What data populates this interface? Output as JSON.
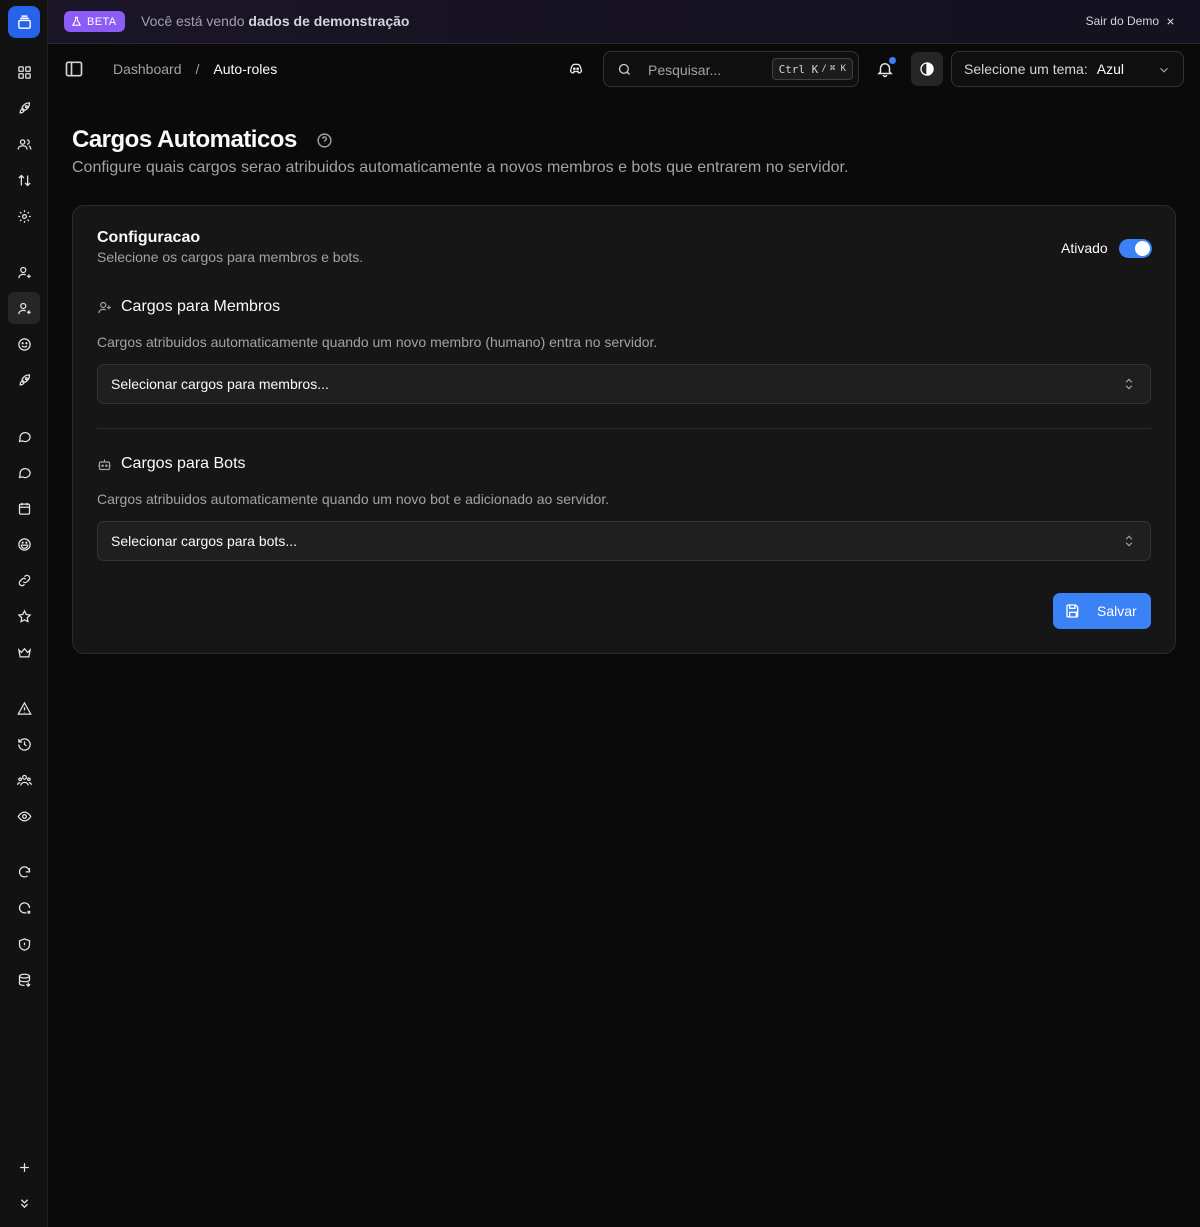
{
  "banner": {
    "badge": "BETA",
    "text_prefix": "Você está vendo",
    "text_bold": "dados de demonstração",
    "exit_label": "Sair do Demo"
  },
  "header": {
    "breadcrumb": {
      "root": "Dashboard",
      "separator": "/",
      "current": "Auto-roles"
    },
    "search": {
      "placeholder": "Pesquisar...",
      "shortcut_ctrl": "Ctrl K",
      "shortcut_sep": "/",
      "shortcut_cmd": "⌘ K"
    },
    "theme": {
      "label": "Selecione um tema:",
      "value": "Azul"
    }
  },
  "sidebar": {
    "icons": [
      "grid-icon",
      "rocket-icon",
      "users-icon",
      "arrows-updown-icon",
      "gear-icon",
      "user-plus-icon",
      "user-plus-icon",
      "smile-icon",
      "rocket-icon",
      "message-icon",
      "message-icon",
      "calendar-icon",
      "emoji-icon",
      "link-icon",
      "star-icon",
      "crown-icon",
      "warning-icon",
      "history-icon",
      "team-icon",
      "eye-icon",
      "shield-refresh-icon",
      "shield-x-icon",
      "shield-icon",
      "database-icon",
      "plus-icon",
      "chevrons-down-icon"
    ],
    "active_index": 6
  },
  "page": {
    "title": "Cargos Automaticos",
    "subtitle": "Configure quais cargos serao atribuidos automaticamente a novos membros e bots que entrarem no servidor."
  },
  "card": {
    "title": "Configuracao",
    "description": "Selecione os cargos para membros e bots.",
    "toggle_label": "Ativado",
    "toggle_on": true,
    "members": {
      "heading": "Cargos para Membros",
      "description": "Cargos atribuidos automaticamente quando um novo membro (humano) entra no servidor.",
      "placeholder": "Selecionar cargos para membros..."
    },
    "bots": {
      "heading": "Cargos para Bots",
      "description": "Cargos atribuidos automaticamente quando um novo bot e adicionado ao servidor.",
      "placeholder": "Selecionar cargos para bots..."
    },
    "save_label": "Salvar"
  },
  "colors": {
    "accent": "#3b82f6",
    "beta": "#8b5cf6",
    "background": "#0a0a0a",
    "card": "#161616"
  }
}
